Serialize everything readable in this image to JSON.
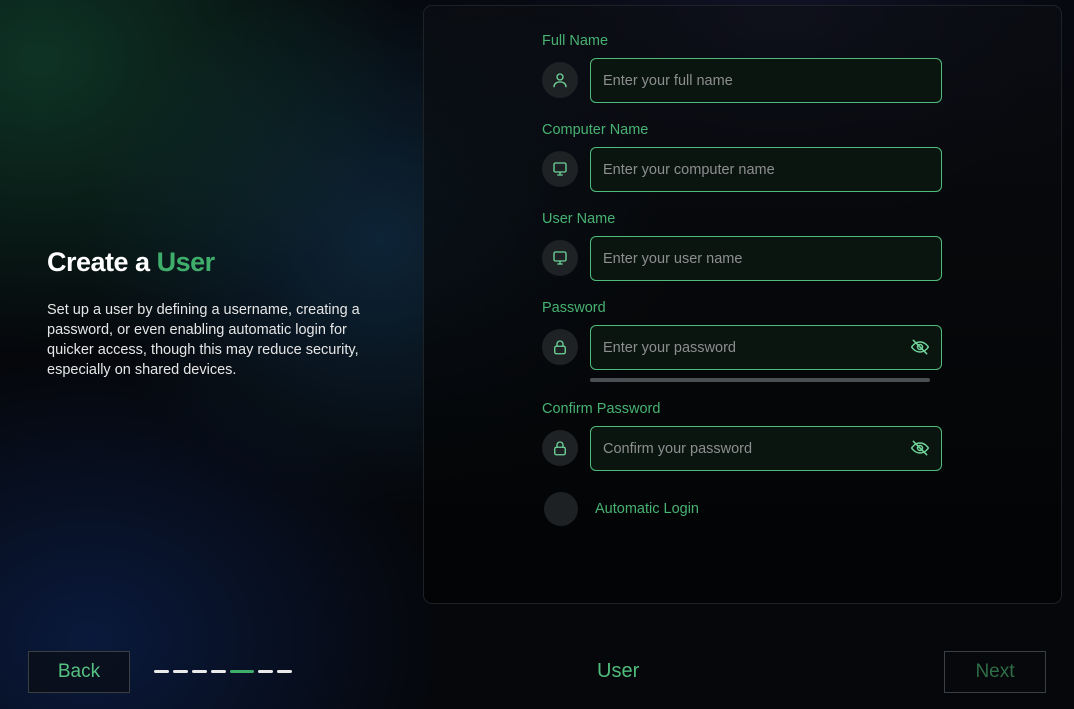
{
  "intro": {
    "title_prefix": "Create a",
    "title_accent": "User",
    "description": "Set up a user by defining a username, creating a password, or even enabling automatic login for quicker access, though this may reduce security, especially on shared devices."
  },
  "form": {
    "full_name": {
      "label": "Full Name",
      "placeholder": "Enter your full name",
      "icon": "user-icon"
    },
    "computer_name": {
      "label": "Computer Name",
      "placeholder": "Enter your computer name",
      "icon": "monitor-icon"
    },
    "user_name": {
      "label": "User Name",
      "placeholder": "Enter your user name",
      "icon": "monitor-icon"
    },
    "password": {
      "label": "Password",
      "placeholder": "Enter your password",
      "icon": "lock-icon",
      "toggle_icon": "eye-off-icon"
    },
    "confirm_password": {
      "label": "Confirm Password",
      "placeholder": "Confirm your password",
      "icon": "lock-icon",
      "toggle_icon": "eye-off-icon"
    },
    "automatic_login": {
      "label": "Automatic Login",
      "enabled": false
    }
  },
  "footer": {
    "back_label": "Back",
    "next_label": "Next",
    "step_name": "User",
    "steps_total": 7,
    "current_step": 5
  },
  "colors": {
    "accent": "#3fae6b",
    "field_border": "#4fbc7b",
    "background": "#05070b"
  }
}
